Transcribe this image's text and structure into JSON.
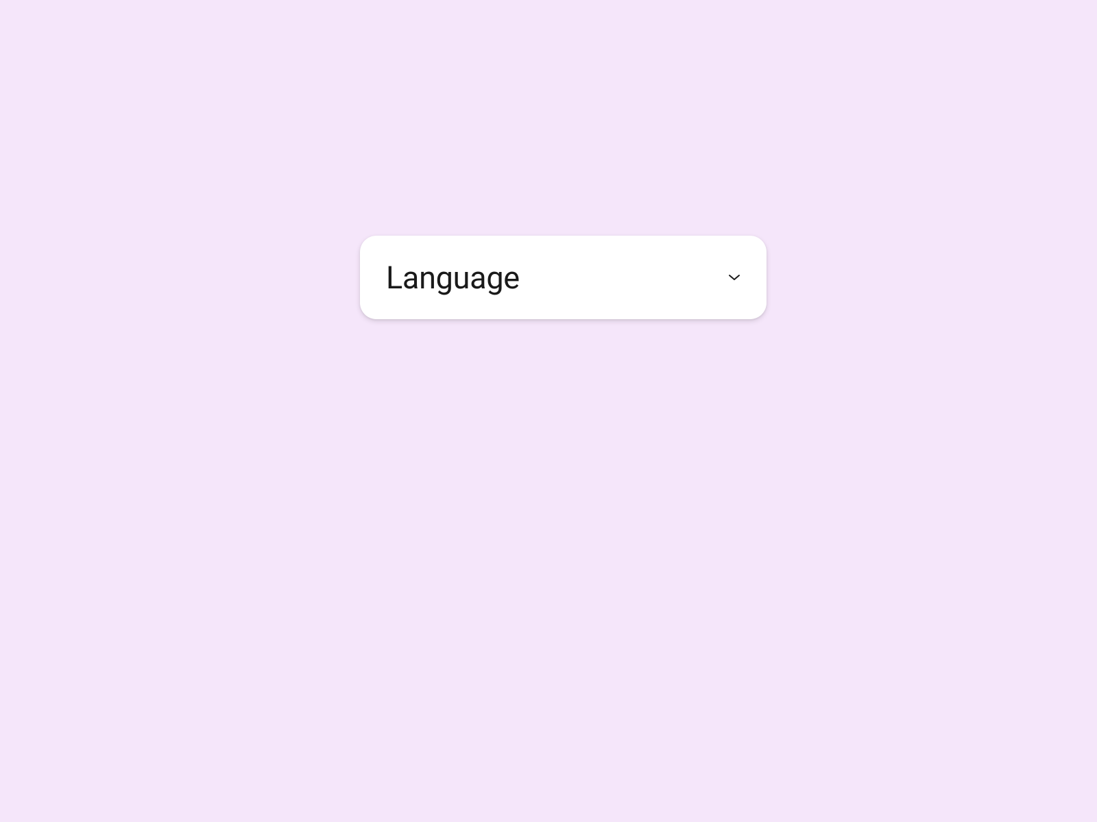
{
  "dropdown": {
    "label": "Language"
  }
}
